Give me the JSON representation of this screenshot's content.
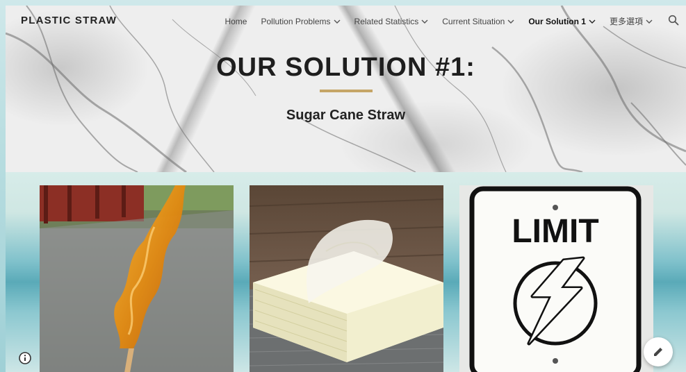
{
  "site": {
    "title": "PLASTIC STRAW"
  },
  "nav": {
    "items": [
      {
        "label": "Home",
        "has_dropdown": false,
        "active": false
      },
      {
        "label": "Pollution Problems",
        "has_dropdown": true,
        "active": false
      },
      {
        "label": "Related Statistics",
        "has_dropdown": true,
        "active": false
      },
      {
        "label": "Current Situation",
        "has_dropdown": true,
        "active": false
      },
      {
        "label": "Our Solution 1",
        "has_dropdown": true,
        "active": true
      },
      {
        "label": "更多選項",
        "has_dropdown": true,
        "active": false
      }
    ],
    "search_icon": "search-icon"
  },
  "hero": {
    "title": "OUR SOLUTION #1:",
    "subtitle": "Sugar Cane Straw",
    "accent_color": "#c5a566"
  },
  "gallery": {
    "cards": [
      {
        "name": "sugar-cane-candy-image"
      },
      {
        "name": "rice-paper-sheets-image"
      },
      {
        "name": "limit-energy-sign-image",
        "sign_text": "LIMIT"
      }
    ]
  },
  "controls": {
    "info_icon": "info-icon",
    "edit_icon": "pencil-icon"
  }
}
